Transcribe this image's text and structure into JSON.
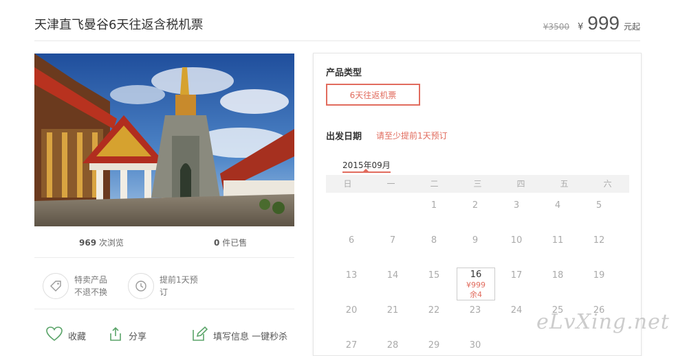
{
  "product": {
    "title": "天津直飞曼谷6天往返含税机票",
    "original_price": "¥3500",
    "currency": "¥",
    "price": "999",
    "price_suffix": "元起"
  },
  "stats": {
    "views_count": "969",
    "views_label": "次浏览",
    "sold_count": "0",
    "sold_label": "件已售"
  },
  "features": [
    {
      "icon": "tag-icon",
      "line1": "特卖产品",
      "line2": "不退不换"
    },
    {
      "icon": "clock-icon",
      "line1": "提前1天预",
      "line2": "订"
    }
  ],
  "actions": [
    {
      "icon": "heart-icon",
      "label": "收藏"
    },
    {
      "icon": "share-icon",
      "label": "分享"
    },
    {
      "icon": "edit-icon",
      "label": "填写信息 一键秒杀"
    }
  ],
  "booking": {
    "type_label": "产品类型",
    "type_option": "6天往返机票",
    "date_label": "出发日期",
    "date_hint": "请至少提前1天预订",
    "month": "2015年09月",
    "weekdays": [
      "日",
      "一",
      "二",
      "三",
      "四",
      "五",
      "六"
    ],
    "selected_day": {
      "day": "16",
      "price": "¥999",
      "remaining": "余4"
    }
  },
  "watermark": "eLvXing.net",
  "colors": {
    "accent": "#e16b5d",
    "action_green": "#5aa469"
  }
}
